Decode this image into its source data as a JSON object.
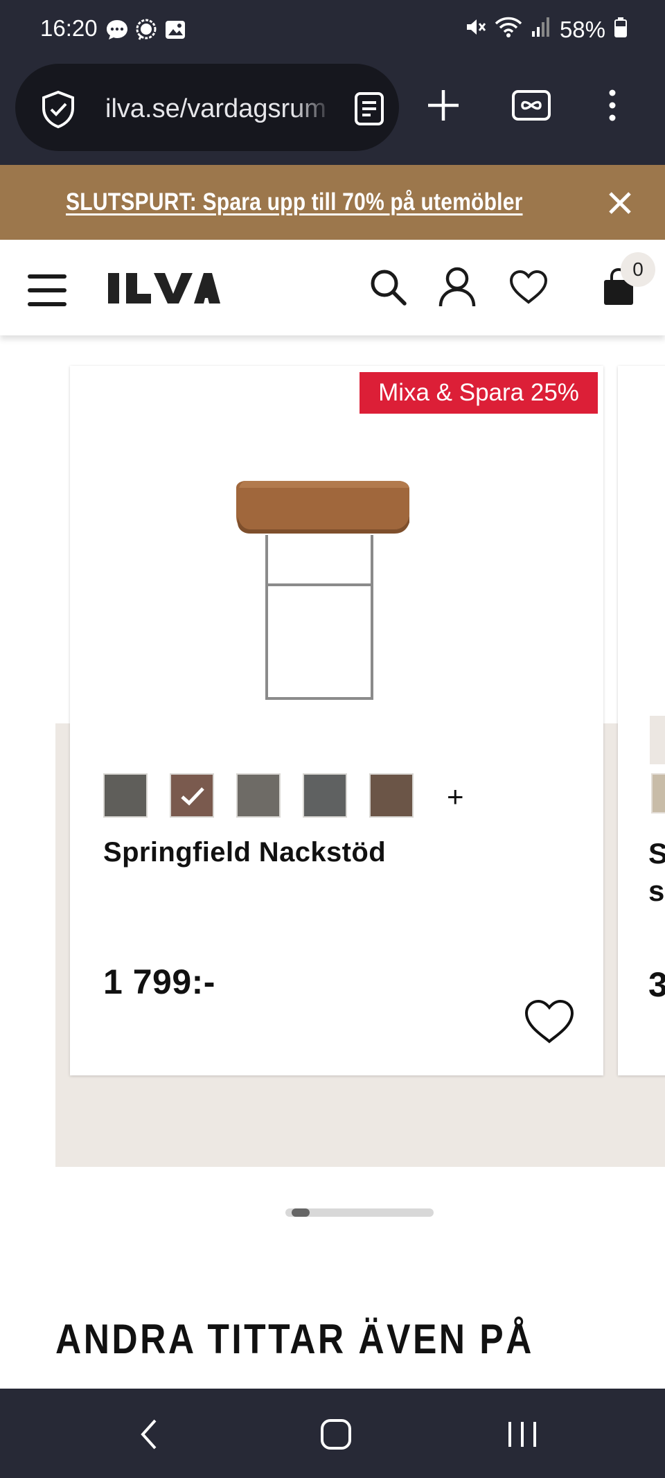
{
  "status_bar": {
    "time": "16:20",
    "battery": "58%",
    "notification_icons": [
      "chat-bubble-icon",
      "messenger-icon",
      "gallery-icon"
    ],
    "system_icons": [
      "mute-icon",
      "wifi-icon",
      "signal-icon",
      "battery-icon"
    ]
  },
  "browser": {
    "url": "ilva.se/vardagsrum",
    "buttons": [
      "reader-mode-icon",
      "new-tab-icon",
      "tabs-icon",
      "menu-icon"
    ]
  },
  "promo_banner": {
    "text": "SLUTSPURT: Spara upp till 70% på utemöbler"
  },
  "header": {
    "logo": "ILVA",
    "cart_count": "0"
  },
  "product": {
    "promo_tag": "Mixa & Spara 25%",
    "name": "Springfield Nackstöd",
    "price": "1 799:-",
    "more_colors": "+",
    "swatches": [
      {
        "color": "#5f5e5a",
        "selected": false
      },
      {
        "color": "#7a5a4e",
        "selected": true
      },
      {
        "color": "#6e6b66",
        "selected": false
      },
      {
        "color": "#5f6161",
        "selected": false
      },
      {
        "color": "#6b5547",
        "selected": false
      }
    ]
  },
  "next_product_peek": {
    "name_line1": "S",
    "name_line2": "s",
    "price": "3"
  },
  "carousel": {
    "position": 0.05
  },
  "section": {
    "title": "ANDRA TITTAR ÄVEN PÅ"
  },
  "colors": {
    "promo_banner": "#9c774c",
    "promo_tag": "#dc1f37",
    "system_bar": "#272936",
    "product_band": "#ede8e3"
  }
}
